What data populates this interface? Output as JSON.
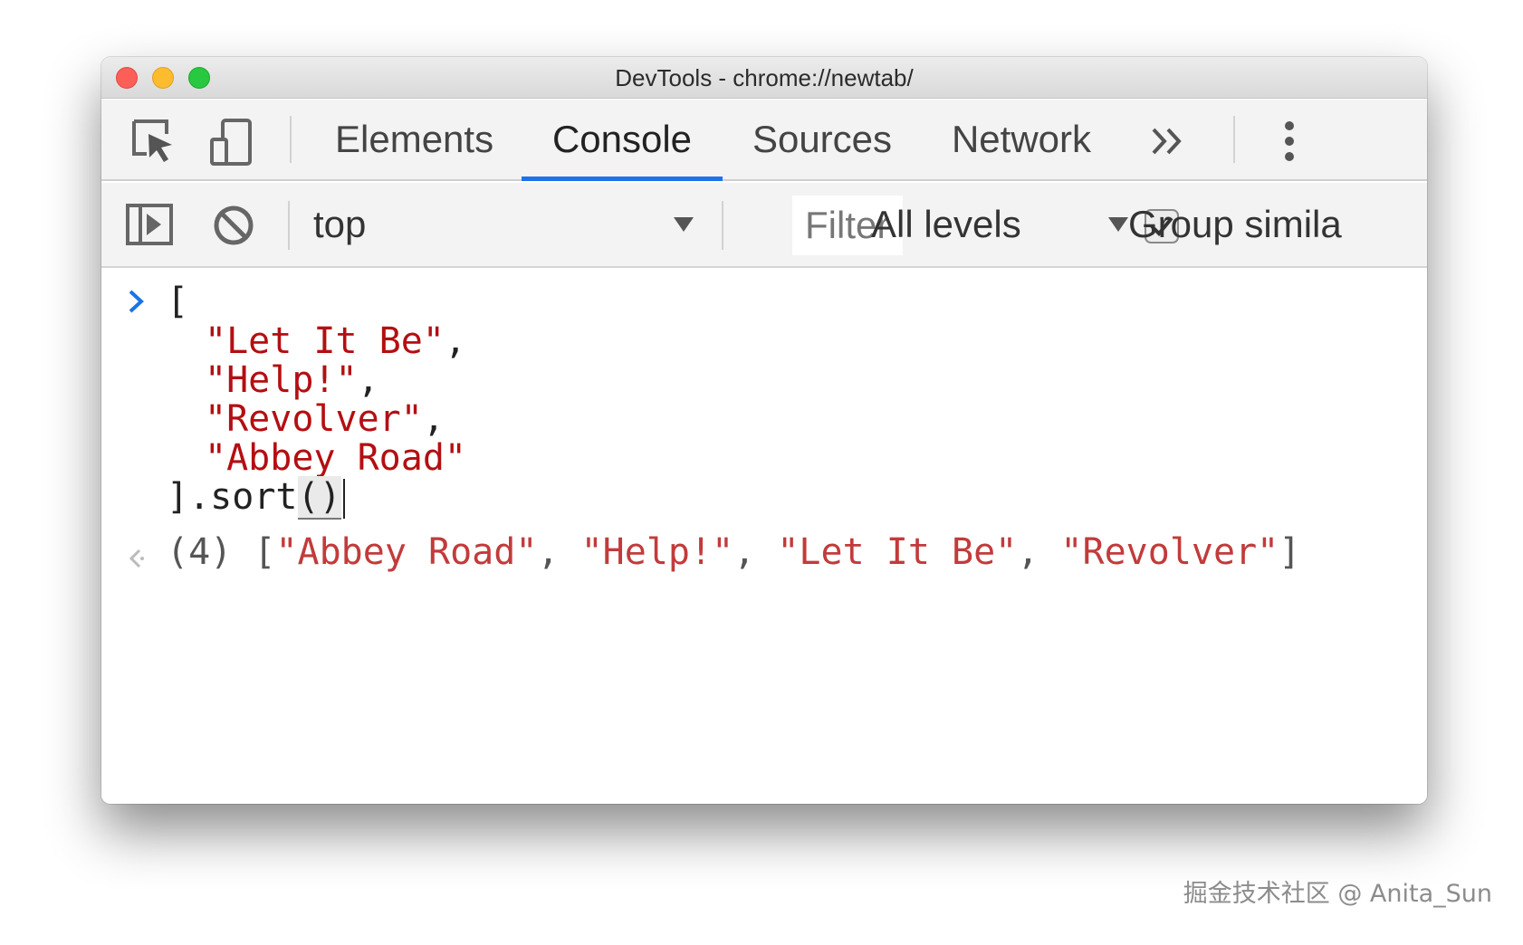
{
  "window": {
    "title": "DevTools - chrome://newtab/"
  },
  "tabs": [
    {
      "label": "Elements",
      "active": false
    },
    {
      "label": "Console",
      "active": true
    },
    {
      "label": "Sources",
      "active": false
    },
    {
      "label": "Network",
      "active": false
    }
  ],
  "toolbar": {
    "icons": [
      "inspect-element-icon",
      "device-toolbar-icon",
      "more-tabs-chevron-icon",
      "kebab-menu-icon"
    ]
  },
  "console_toolbar": {
    "context": "top",
    "filter_placeholder": "Filter",
    "levels": "All levels",
    "group_similar_label": "Group simila",
    "group_similar_checked": true
  },
  "input": {
    "open_bracket": "[",
    "items": [
      "\"Let It Be\"",
      "\"Help!\"",
      "\"Revolver\"",
      "\"Abbey Road\""
    ],
    "comma": ",",
    "close_prefix": "].sort",
    "parens": "()"
  },
  "result": {
    "count": "(4)",
    "open": "[",
    "items": [
      "\"Abbey Road\"",
      "\"Help!\"",
      "\"Let It Be\"",
      "\"Revolver\""
    ],
    "sep": ", ",
    "close": "]"
  },
  "watermark": "掘金技术社区 @ Anita_Sun",
  "colors": {
    "accent": "#1a73e8",
    "string": "#b30f12"
  }
}
